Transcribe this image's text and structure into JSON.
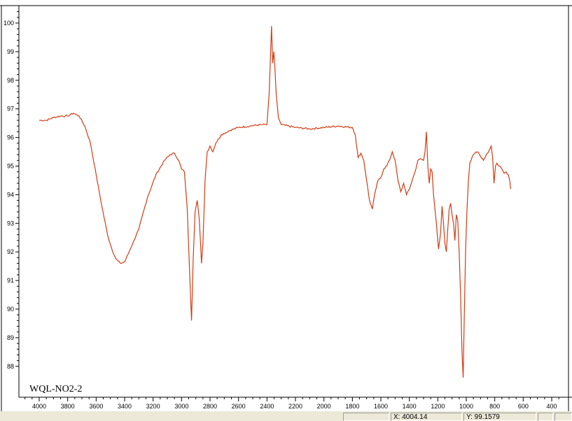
{
  "sample_label": "WQL-NO2-2",
  "status": {
    "cell1": "",
    "x_readout": "X: 4004.14",
    "y_readout": "Y: 99.1579",
    "cell4": ""
  },
  "colors": {
    "trace": "#d23c14",
    "frame": "#000000",
    "plot_bg": "#ffffff",
    "window_bg": "#ece9d8"
  },
  "chart_data": {
    "type": "line",
    "xlabel": "",
    "ylabel": "",
    "xlim": [
      4100,
      300
    ],
    "ylim": [
      87.2,
      100.6
    ],
    "x_reversed": true,
    "grid": false,
    "x_ticks": [
      4000,
      3800,
      3600,
      3400,
      3200,
      3000,
      2800,
      2600,
      2400,
      2200,
      2000,
      1800,
      1600,
      1400,
      1200,
      1000,
      800,
      600,
      400
    ],
    "y_ticks": [
      88,
      89,
      90,
      91,
      92,
      93,
      94,
      95,
      96,
      97,
      98,
      99,
      100
    ],
    "series": [
      {
        "points": [
          [
            4000,
            96.6
          ],
          [
            3950,
            96.6
          ],
          [
            3900,
            96.7
          ],
          [
            3850,
            96.75
          ],
          [
            3800,
            96.75
          ],
          [
            3760,
            96.85
          ],
          [
            3720,
            96.75
          ],
          [
            3680,
            96.4
          ],
          [
            3640,
            95.8
          ],
          [
            3600,
            94.7
          ],
          [
            3560,
            93.6
          ],
          [
            3520,
            92.6
          ],
          [
            3490,
            92.1
          ],
          [
            3460,
            91.75
          ],
          [
            3430,
            91.6
          ],
          [
            3400,
            91.65
          ],
          [
            3360,
            92.1
          ],
          [
            3300,
            92.8
          ],
          [
            3240,
            93.9
          ],
          [
            3180,
            94.7
          ],
          [
            3120,
            95.2
          ],
          [
            3080,
            95.4
          ],
          [
            3050,
            95.45
          ],
          [
            3020,
            95.2
          ],
          [
            3000,
            94.9
          ],
          [
            2980,
            94.8
          ],
          [
            2960,
            93.5
          ],
          [
            2945,
            91.5
          ],
          [
            2930,
            89.6
          ],
          [
            2918,
            91.8
          ],
          [
            2905,
            93.4
          ],
          [
            2890,
            93.8
          ],
          [
            2875,
            93.1
          ],
          [
            2860,
            91.6
          ],
          [
            2850,
            92.3
          ],
          [
            2835,
            94.5
          ],
          [
            2820,
            95.5
          ],
          [
            2800,
            95.7
          ],
          [
            2780,
            95.5
          ],
          [
            2760,
            95.8
          ],
          [
            2720,
            96.1
          ],
          [
            2660,
            96.25
          ],
          [
            2600,
            96.35
          ],
          [
            2520,
            96.4
          ],
          [
            2440,
            96.45
          ],
          [
            2400,
            96.45
          ],
          [
            2385,
            97.5
          ],
          [
            2375,
            98.9
          ],
          [
            2368,
            99.9
          ],
          [
            2360,
            98.6
          ],
          [
            2352,
            99.0
          ],
          [
            2345,
            98.5
          ],
          [
            2335,
            97.5
          ],
          [
            2320,
            96.7
          ],
          [
            2300,
            96.45
          ],
          [
            2200,
            96.35
          ],
          [
            2100,
            96.3
          ],
          [
            2000,
            96.35
          ],
          [
            1900,
            96.4
          ],
          [
            1800,
            96.35
          ],
          [
            1780,
            96.1
          ],
          [
            1760,
            95.3
          ],
          [
            1740,
            95.45
          ],
          [
            1720,
            95.2
          ],
          [
            1700,
            94.5
          ],
          [
            1680,
            93.8
          ],
          [
            1660,
            93.5
          ],
          [
            1640,
            94.1
          ],
          [
            1620,
            94.5
          ],
          [
            1600,
            94.6
          ],
          [
            1580,
            94.9
          ],
          [
            1560,
            95.0
          ],
          [
            1540,
            95.2
          ],
          [
            1520,
            95.5
          ],
          [
            1500,
            95.2
          ],
          [
            1480,
            94.5
          ],
          [
            1460,
            94.1
          ],
          [
            1440,
            94.4
          ],
          [
            1420,
            94.0
          ],
          [
            1400,
            94.2
          ],
          [
            1380,
            94.5
          ],
          [
            1360,
            94.8
          ],
          [
            1340,
            95.2
          ],
          [
            1320,
            95.25
          ],
          [
            1300,
            95.2
          ],
          [
            1290,
            95.5
          ],
          [
            1280,
            96.2
          ],
          [
            1270,
            95.0
          ],
          [
            1260,
            94.4
          ],
          [
            1250,
            94.9
          ],
          [
            1240,
            94.8
          ],
          [
            1230,
            94.0
          ],
          [
            1210,
            93.0
          ],
          [
            1195,
            92.1
          ],
          [
            1180,
            92.7
          ],
          [
            1170,
            93.6
          ],
          [
            1160,
            93.0
          ],
          [
            1150,
            92.3
          ],
          [
            1140,
            92.0
          ],
          [
            1130,
            92.8
          ],
          [
            1120,
            93.5
          ],
          [
            1110,
            93.7
          ],
          [
            1100,
            93.3
          ],
          [
            1090,
            93.0
          ],
          [
            1080,
            92.4
          ],
          [
            1070,
            93.3
          ],
          [
            1060,
            93.1
          ],
          [
            1050,
            92.0
          ],
          [
            1040,
            90.5
          ],
          [
            1030,
            88.5
          ],
          [
            1022,
            87.6
          ],
          [
            1015,
            89.5
          ],
          [
            1005,
            92.0
          ],
          [
            995,
            93.5
          ],
          [
            985,
            94.5
          ],
          [
            975,
            95.1
          ],
          [
            960,
            95.3
          ],
          [
            940,
            95.45
          ],
          [
            920,
            95.5
          ],
          [
            900,
            95.35
          ],
          [
            880,
            95.2
          ],
          [
            860,
            95.4
          ],
          [
            840,
            95.55
          ],
          [
            825,
            95.7
          ],
          [
            815,
            95.3
          ],
          [
            805,
            94.4
          ],
          [
            795,
            95.0
          ],
          [
            785,
            95.1
          ],
          [
            770,
            95.0
          ],
          [
            750,
            94.9
          ],
          [
            735,
            94.75
          ],
          [
            720,
            94.8
          ],
          [
            705,
            94.7
          ],
          [
            695,
            94.5
          ],
          [
            688,
            94.2
          ]
        ]
      }
    ]
  }
}
